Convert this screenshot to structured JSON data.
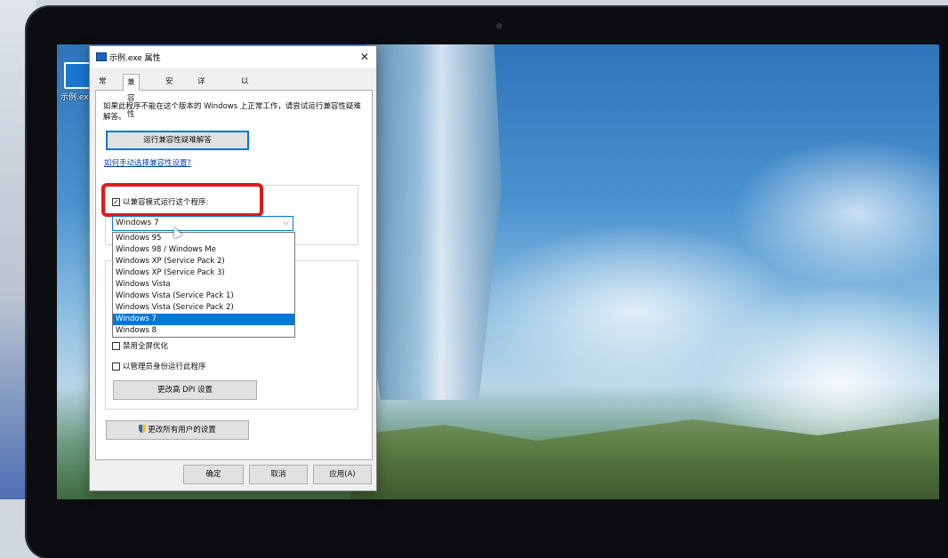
{
  "desktop": {
    "icon_label": "示例.exe"
  },
  "dialog": {
    "title": "示例.exe 属性",
    "close_glyph": "✕",
    "tabs": [
      "常规",
      "兼容性",
      "安全",
      "详细信息",
      "以前的版本"
    ],
    "active_tab": "兼容性",
    "description": "如果此程序不能在这个版本的 Windows 上正常工作，请尝试运行兼容性疑难解答。",
    "troubleshooter_button": "运行兼容性疑难解答",
    "manual_link": "如何手动选择兼容性设置?",
    "compat_mode": {
      "checkbox_label": "以兼容模式运行这个程序:",
      "checked": true,
      "selected_value": "Windows 7",
      "options": [
        "Windows 95",
        "Windows 98 / Windows Me",
        "Windows XP (Service Pack 2)",
        "Windows XP (Service Pack 3)",
        "Windows Vista",
        "Windows Vista (Service Pack 1)",
        "Windows Vista (Service Pack 2)",
        "Windows 7",
        "Windows 8"
      ],
      "highlighted_option": "Windows 7"
    },
    "settings": {
      "disable_fullscreen_label": "禁用全屏优化",
      "run_as_admin_label": "以管理员身份运行此程序",
      "dpi_button": "更改高 DPI 设置"
    },
    "all_users_button": "更改所有用户的设置",
    "footer": {
      "ok": "确定",
      "cancel": "取消",
      "apply": "应用(A)"
    }
  },
  "colors": {
    "accent": "#0078d7",
    "highlight_box": "#e01919"
  }
}
